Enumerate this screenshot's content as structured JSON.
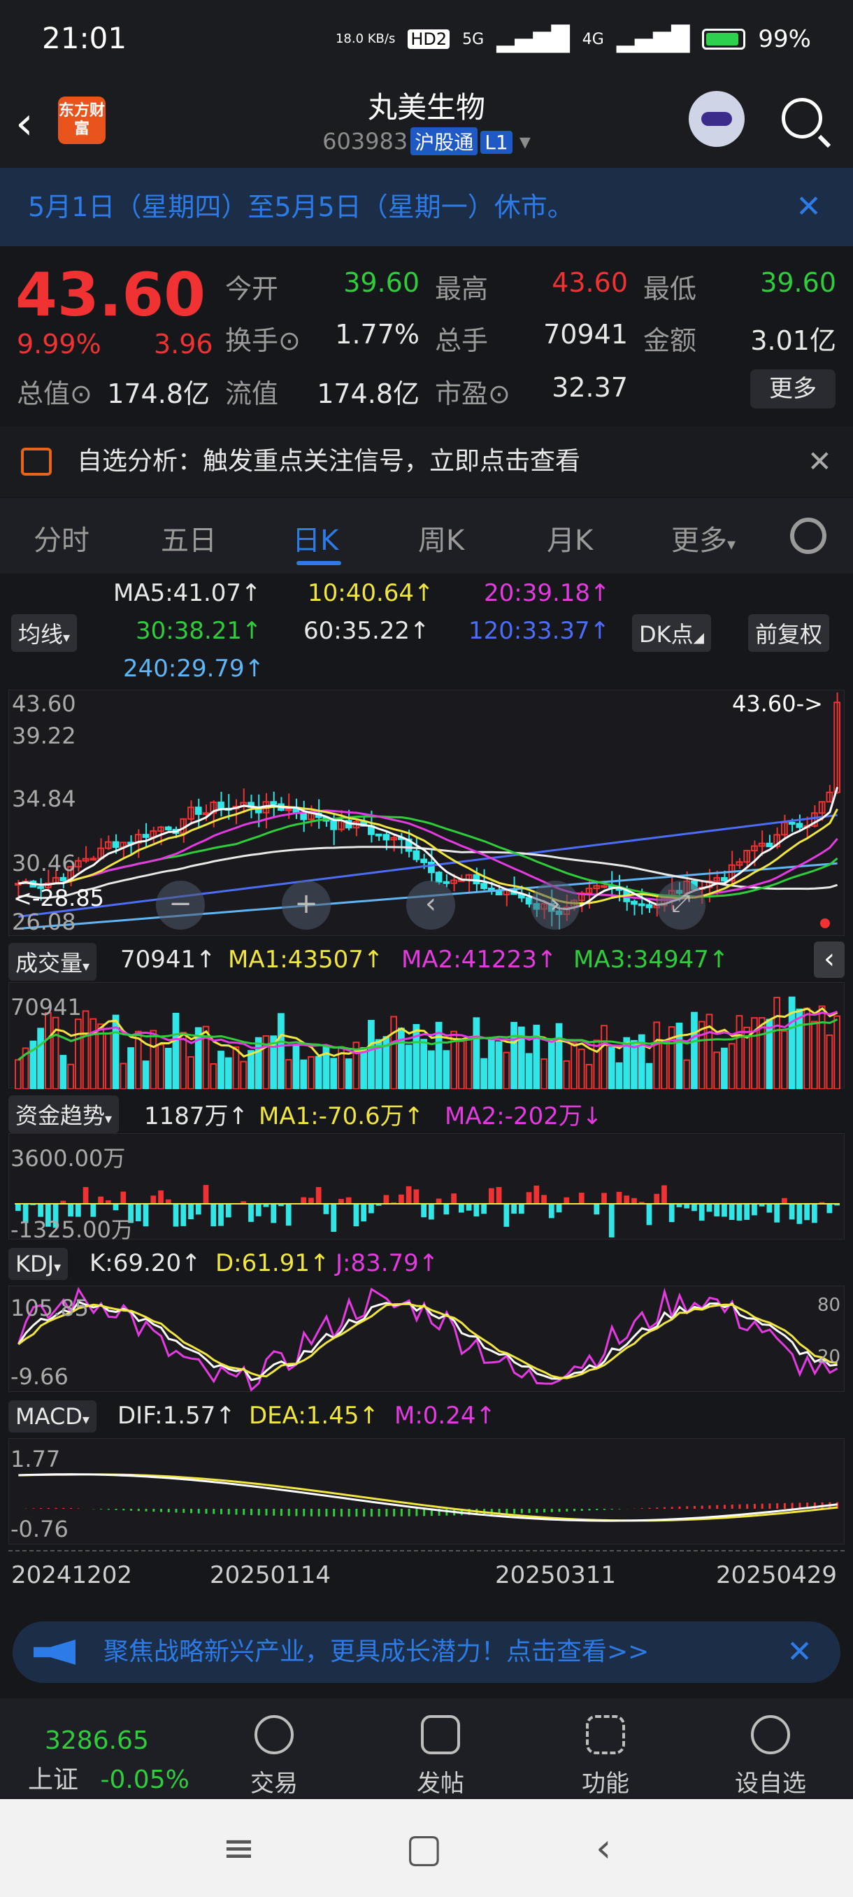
{
  "status_bar": {
    "time": "21:01",
    "net_speed": "18.0 KB/s",
    "hd": "HD2",
    "sig1": "5G",
    "sig2": "4G",
    "battery": "99%"
  },
  "header": {
    "title": "丸美生物",
    "code": "603983",
    "tag1": "沪股通",
    "tag2": "L1",
    "logo": "东方财富"
  },
  "notice": {
    "text": "5月1日（星期四）至5月5日（星期一）休市。"
  },
  "quote": {
    "price": "43.60",
    "change_pct": "9.99%",
    "change": "3.96",
    "open_label": "今开",
    "open": "39.60",
    "high_label": "最高",
    "high": "43.60",
    "low_label": "最低",
    "low": "39.60",
    "turnover_label": "换手",
    "turnover": "1.77%",
    "volume_label": "总手",
    "volume": "70941",
    "amount_label": "金额",
    "amount": "3.01亿",
    "mktcap_label": "总值",
    "mktcap": "174.8亿",
    "float_label": "流值",
    "float": "174.8亿",
    "pe_label": "市盈",
    "pe": "32.37",
    "more": "更多"
  },
  "analysis": {
    "text": "自选分析：触发重点关注信号，立即点击查看"
  },
  "tabs": [
    "分时",
    "五日",
    "日K",
    "周K",
    "月K",
    "更多"
  ],
  "kline": {
    "indicator_btn": "均线",
    "dk_btn": "DK点",
    "fq_btn": "前复权",
    "ma5": "MA5:41.07↑",
    "ma10": "10:40.64↑",
    "ma20": "20:39.18↑",
    "ma30": "30:38.21↑",
    "ma60": "60:35.22↑",
    "ma120": "120:33.37↑",
    "ma240": "240:29.79↑",
    "y_labels": [
      "43.60",
      "39.22",
      "34.84",
      "30.46",
      "26.08"
    ],
    "last_price_tag": "43.60->",
    "low_tag": "<-28.85"
  },
  "volume": {
    "name": "成交量",
    "val": "70941↑",
    "ma1": "MA1:43507↑",
    "ma2": "MA2:41223↑",
    "ma3": "MA3:34947↑",
    "top": "70941"
  },
  "fund": {
    "name": "资金趋势",
    "val": "1187万↑",
    "ma1": "MA1:-70.6万↑",
    "ma2": "MA2:-202万↓",
    "top": "3600.00万",
    "bottom": "-1325.00万"
  },
  "kdj": {
    "name": "KDJ",
    "k": "K:69.20↑",
    "d": "D:61.91↑",
    "j": "J:83.79↑",
    "top": "105.85",
    "bottom": "-9.66",
    "l80": "80",
    "l20": "20"
  },
  "macd": {
    "name": "MACD",
    "dif": "DIF:1.57↑",
    "dea": "DEA:1.45↑",
    "m": "M:0.24↑",
    "top": "1.77",
    "bottom": "-0.76"
  },
  "dates": [
    "20241202",
    "20250114",
    "20250311",
    "20250429"
  ],
  "promo": {
    "text": "聚焦战略新兴产业，更具成长潜力！点击查看>>"
  },
  "bottom": {
    "index_value": "3286.65",
    "index_name": "上证",
    "index_change": "-0.05%",
    "trade": "交易",
    "post": "发帖",
    "func": "功能",
    "watch": "设自选"
  },
  "colors": {
    "up": "#f03232",
    "down": "#2fcc3c",
    "accent": "#2d7be6"
  }
}
